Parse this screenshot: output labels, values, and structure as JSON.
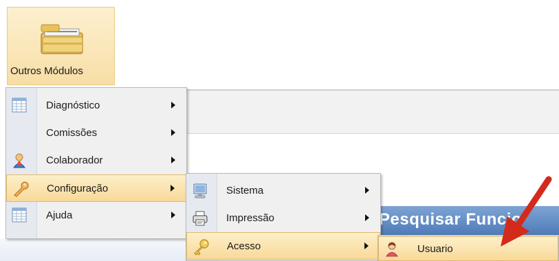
{
  "toolbar": {
    "module_button": {
      "label": "Outros Módulos",
      "icon": "folder-stack-icon"
    }
  },
  "background": {
    "panel_title": "Pesquisar Funcio"
  },
  "menu_main": {
    "items": [
      {
        "label": "Diagnóstico",
        "icon": "grid-table-icon",
        "has_submenu": true
      },
      {
        "label": "Comissões",
        "icon": "",
        "has_submenu": true
      },
      {
        "label": "Colaborador",
        "icon": "person-icon",
        "has_submenu": true
      },
      {
        "label": "Configuração",
        "icon": "wrench-icon",
        "has_submenu": true,
        "highlighted": true
      },
      {
        "label": "Ajuda",
        "icon": "grid-table-icon",
        "has_submenu": true
      }
    ]
  },
  "menu_config": {
    "items": [
      {
        "label": "Sistema",
        "icon": "monitor-icon",
        "has_submenu": true
      },
      {
        "label": "Impressão",
        "icon": "printer-icon",
        "has_submenu": true
      },
      {
        "label": "Acesso",
        "icon": "key-icon",
        "has_submenu": true,
        "highlighted": true
      }
    ]
  },
  "menu_access": {
    "items": [
      {
        "label": "Usuario",
        "icon": "user-icon",
        "highlighted": true
      }
    ]
  },
  "colors": {
    "highlight": "#f8d999",
    "menu_bg": "#f0f0f0",
    "annotation_arrow": "#d42a1a",
    "panel_title_bg": "#4d79b6"
  }
}
